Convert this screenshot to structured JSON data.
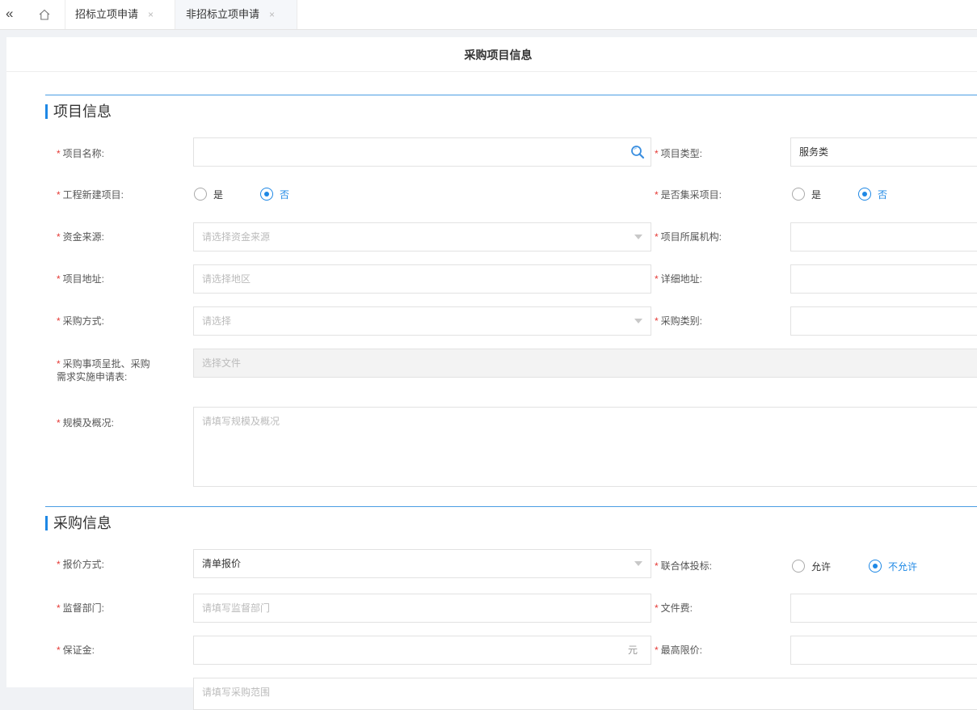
{
  "tabs": {
    "items": [
      {
        "label": "招标立项申请",
        "close": "×"
      },
      {
        "label": "非招标立项申请",
        "close": "×"
      }
    ]
  },
  "page": {
    "title": "采购项目信息"
  },
  "sections": {
    "project": {
      "title": "项目信息"
    },
    "purchase": {
      "title": "采购信息"
    }
  },
  "project": {
    "name": {
      "label": "项目名称:",
      "value": ""
    },
    "type": {
      "label": "项目类型:",
      "value": "服务类"
    },
    "new_build": {
      "label": "工程新建项目:",
      "options": [
        "是",
        "否"
      ],
      "selected": "否"
    },
    "central": {
      "label": "是否集采项目:",
      "options": [
        "是",
        "否"
      ],
      "selected": "否"
    },
    "fund": {
      "label": "资金来源:",
      "placeholder": "请选择资金来源"
    },
    "org": {
      "label": "项目所属机构:",
      "value": ""
    },
    "address": {
      "label": "项目地址:",
      "placeholder": "请选择地区"
    },
    "detail_address": {
      "label": "详细地址:",
      "value": ""
    },
    "method": {
      "label": "采购方式:",
      "placeholder": "请选择"
    },
    "category": {
      "label": "采购类别:",
      "value": ""
    },
    "approval": {
      "label_line1": "采购事项呈批、采购",
      "label_line2": "需求实施申请表:",
      "placeholder": "选择文件"
    },
    "scale": {
      "label": "规模及概况:",
      "placeholder": "请填写规模及概况"
    }
  },
  "purchase": {
    "quote": {
      "label": "报价方式:",
      "value": "清单报价"
    },
    "consortium": {
      "label": "联合体投标:",
      "options": [
        "允许",
        "不允许"
      ],
      "selected": "不允许"
    },
    "supervise": {
      "label": "监督部门:",
      "placeholder": "请填写监督部门"
    },
    "doc_fee": {
      "label": "文件费:",
      "value": ""
    },
    "deposit": {
      "label": "保证金:",
      "value": "",
      "suffix": "元"
    },
    "max_price": {
      "label": "最高限价:",
      "value": ""
    },
    "scope": {
      "placeholder": "请填写采购范围"
    }
  },
  "colors": {
    "accent": "#1e88e5",
    "required": "#e53935"
  }
}
